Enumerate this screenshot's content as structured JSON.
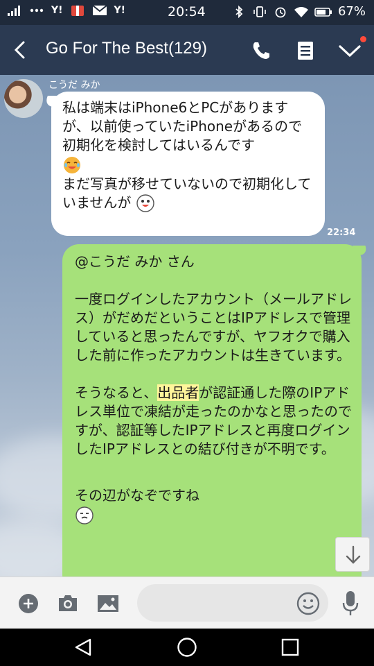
{
  "status_bar": {
    "time": "20:54",
    "battery": "67%",
    "left_icons": [
      "signal-icon",
      "more-dots-icon",
      "yahoo-icon",
      "gift-icon",
      "mail-icon",
      "yahoo-icon"
    ],
    "right_icons": [
      "bluetooth-icon",
      "vibrate-icon",
      "alarm-icon",
      "wifi-icon",
      "battery-icon"
    ],
    "yahoo_label": "Y!"
  },
  "header": {
    "title": "Go For The Best(129)",
    "back_icon": "chevron-left-icon",
    "call_icon": "phone-icon",
    "notes_icon": "notes-icon",
    "menu_icon": "chevron-down-icon",
    "accent": "#2b3a52"
  },
  "chat": {
    "incoming": {
      "sender": "こうだ みか",
      "lines": [
        "私は端末はiPhone6とPCがありますが、以前使っていたiPhoneがあるので初期化を検討してはいるんです",
        "まだ写真が移せていないので初期化していませんが"
      ],
      "time": "22:34"
    },
    "outgoing": {
      "mention": "@こうだ みか さん",
      "paragraph1": "一度ログインしたアカウント（メールアドレス）がだめだということはIPアドレスで管理していると思ったんですが、ヤフオクで購入した前に作ったアカウントは生きています。",
      "paragraph2_before": "そうなると、",
      "paragraph2_highlight": "出品者",
      "paragraph2_after": "が認証通した際のIPアドレス単位で凍結が走ったのかなと思ったのですが、認証等したIPアドレスと再度ログインしたIPアドレスとの結び付きが不明です。",
      "paragraph3": "その辺がなぞですね",
      "bubble_color": "#a6e17a"
    }
  },
  "input_bar": {
    "placeholder": "",
    "icons": [
      "plus-icon",
      "camera-icon",
      "image-icon",
      "smiley-icon",
      "mic-icon"
    ]
  },
  "nav_bar": {
    "icons": [
      "nav-back-icon",
      "nav-home-icon",
      "nav-recent-icon"
    ]
  }
}
